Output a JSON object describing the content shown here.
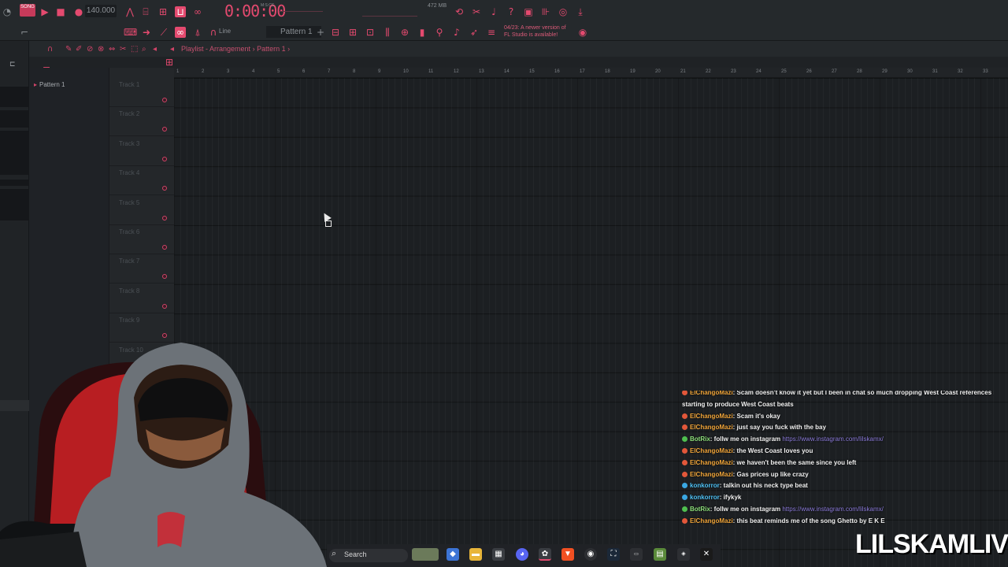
{
  "toolbar": {
    "song_mode": "SONG",
    "tempo": "140.000",
    "time": "0:00:00",
    "time_unit": "M:S:CS",
    "memory": "472 MB",
    "pattern": "Pattern 1",
    "snap": "Line",
    "notice_line1": "04/23: A newer version of",
    "notice_line2": "FL Studio is available!"
  },
  "playlist": {
    "title": "Playlist - Arrangement",
    "separator": "›",
    "pattern": "Pattern 1",
    "patterns": [
      "Pattern 1"
    ],
    "tracks": [
      "Track 1",
      "Track 2",
      "Track 3",
      "Track 4",
      "Track 5",
      "Track 6",
      "Track 7",
      "Track 8",
      "Track 9",
      "Track 10"
    ],
    "bars": [
      "1",
      "2",
      "3",
      "4",
      "5",
      "6",
      "7",
      "8",
      "9",
      "10",
      "11",
      "12",
      "13",
      "14",
      "15",
      "16",
      "17",
      "18",
      "19",
      "20",
      "21",
      "22",
      "23",
      "24",
      "25",
      "26",
      "27",
      "28",
      "29",
      "30",
      "31",
      "32",
      "33"
    ]
  },
  "chat": [
    {
      "user": "ElChangoMazi",
      "text": ": Scam doesn't know it yet but I been in chat so much dropping West Coast references he's",
      "color": "orange"
    },
    {
      "user": "",
      "text": "starting to produce West Coast beats",
      "color": "orange"
    },
    {
      "user": "ElChangoMazi",
      "text": ": Scam it's okay",
      "color": "orange"
    },
    {
      "user": "ElChangoMazi",
      "text": ": just say you fuck with the bay",
      "color": "orange"
    },
    {
      "user": "BotRix",
      "text": ": follw me on instagram ",
      "link": "https://www.instagram.com/lilskamx/",
      "color": "green"
    },
    {
      "user": "ElChangoMazi",
      "text": ": the West Coast loves you",
      "color": "orange"
    },
    {
      "user": "ElChangoMazi",
      "text": ": we haven't been the same since you left",
      "color": "orange"
    },
    {
      "user": "ElChangoMazi",
      "text": ": Gas prices up like crazy",
      "color": "orange"
    },
    {
      "user": "konkorror",
      "text": ": talkin out his neck type beat",
      "color": "blue"
    },
    {
      "user": "konkorror",
      "text": ": ifykyk",
      "color": "blue"
    },
    {
      "user": "BotRix",
      "text": ": follw me on instagram ",
      "link": "https://www.instagram.com/lilskamx/",
      "color": "green"
    },
    {
      "user": "ElChangoMazi",
      "text": ": this beat reminds me of the song Ghetto by E K E",
      "color": "orange"
    }
  ],
  "taskbar": {
    "search_label": "Search"
  },
  "brand": "LILSKAMLIVE",
  "colors": {
    "accent": "#e44a6f",
    "background": "#1e2124"
  }
}
